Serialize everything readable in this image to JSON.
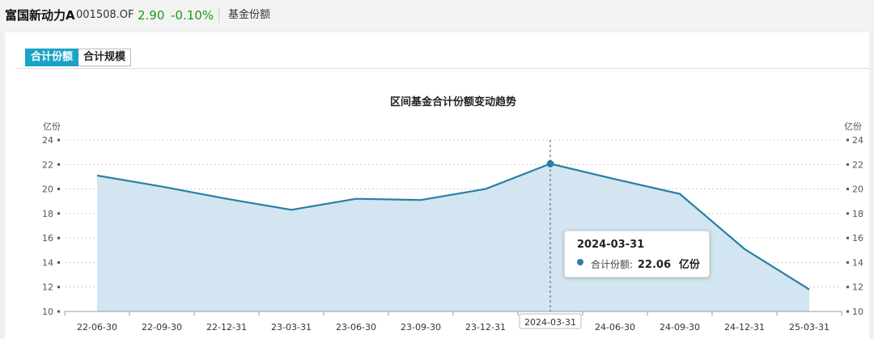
{
  "header": {
    "fund_name": "富国新动力A",
    "fund_code": "001508.OF",
    "price": "2.90",
    "change": "-0.10%",
    "section": "基金份额",
    "change_color": "#1a9a1a"
  },
  "tabs": [
    {
      "label": "合计份额",
      "active": true
    },
    {
      "label": "合计规模",
      "active": false
    }
  ],
  "tooltip": {
    "date": "2024-03-31",
    "series_label": "合计份额:",
    "value": "22.06",
    "unit": "亿份"
  },
  "chart_data": {
    "type": "area",
    "title": "区间基金合计份额变动趋势",
    "ylabel": "亿份",
    "ylabel_right": "亿份",
    "ylim": [
      10,
      24
    ],
    "yticks": [
      10,
      12,
      14,
      16,
      18,
      20,
      22,
      24
    ],
    "categories": [
      "22-06-30",
      "22-09-30",
      "22-12-31",
      "23-03-31",
      "23-06-30",
      "23-09-30",
      "23-12-31",
      "24-03-31",
      "24-06-30",
      "24-09-30",
      "24-12-31",
      "25-03-31"
    ],
    "highlight_label": "2024-03-31",
    "highlight_index": 7,
    "series": [
      {
        "values": [
          21.1,
          20.2,
          19.2,
          18.3,
          19.2,
          19.1,
          20.0,
          22.06,
          20.8,
          19.6,
          15.1,
          11.8
        ]
      }
    ],
    "line_color": "#2b7ea8",
    "fill_color": "#d2e5f1",
    "grid": true,
    "legend": "none"
  }
}
